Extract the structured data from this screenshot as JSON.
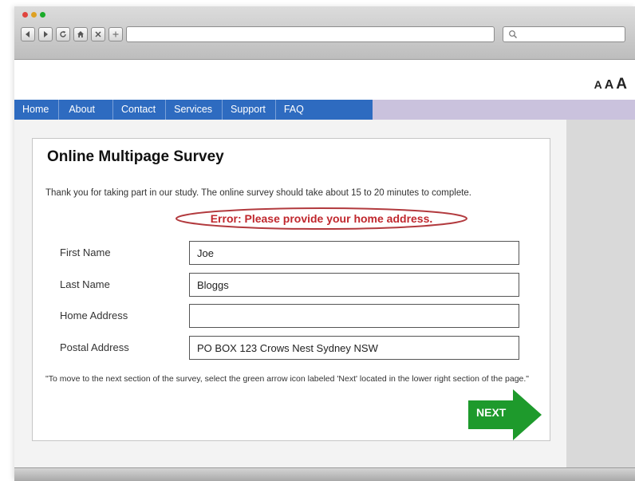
{
  "browser": {
    "nav_icons": [
      "back-arrow-icon",
      "forward-arrow-icon",
      "reload-icon",
      "home-icon",
      "close-icon",
      "new-tab-plus-icon"
    ],
    "url": "",
    "search_value": ""
  },
  "font_size_controls": [
    "A",
    "A",
    "A"
  ],
  "nav": {
    "items": [
      "Home",
      "About",
      "Contact",
      "Services",
      "Support",
      "FAQ"
    ]
  },
  "survey": {
    "title": "Online Multipage Survey",
    "intro": "Thank you for taking part in our study. The online survey should take about 15 to 20 minutes to complete.",
    "error": "Error:  Please provide your home address.",
    "fields": [
      {
        "label": "First Name",
        "value": "Joe"
      },
      {
        "label": "Last Name",
        "value": "Bloggs"
      },
      {
        "label": "Home Address",
        "value": ""
      },
      {
        "label": "Postal Address",
        "value": "PO BOX 123 Crows Nest Sydney NSW"
      }
    ],
    "instruction": "\"To move to the next section of the survey, select the  green arrow icon labeled 'Next' located in the lower right section of the page.\"",
    "next_label": "NEXT"
  },
  "colors": {
    "nav_blue": "#2e6bc0",
    "nav_lavender": "#cac2dd",
    "error_red": "#c0272d",
    "next_green": "#1e9a2c"
  }
}
